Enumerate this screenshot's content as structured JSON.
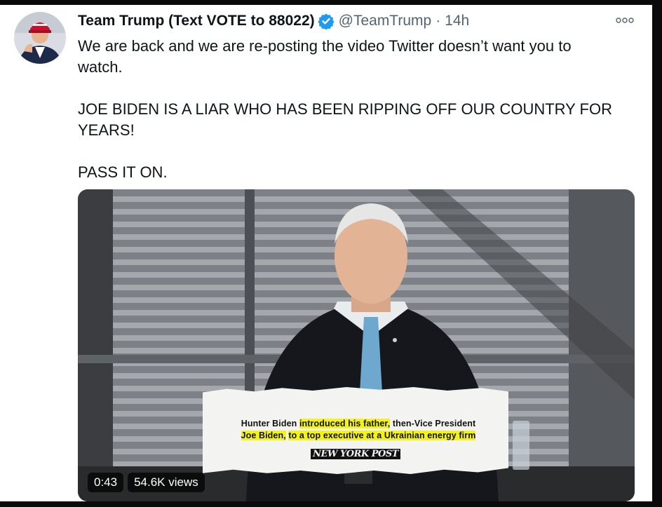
{
  "tweet": {
    "display_name": "Team Trump (Text VOTE to 88022)",
    "handle": "@TeamTrump",
    "separator": "·",
    "timestamp": "14h",
    "paragraphs": [
      "We are back and we are re-posting the video Twitter doesn’t want you to\nwatch.",
      "JOE BIDEN IS A LIAR WHO HAS BEEN RIPPING OFF OUR COUNTRY FOR\nYEARS!",
      "PASS IT ON."
    ]
  },
  "icons": {
    "verified": "verified-badge-icon",
    "more": "more-options-icon"
  },
  "video": {
    "caption": {
      "part1": "Hunter Biden ",
      "part2": "introduced his father,",
      "part3": " then-Vice President",
      "part4": "Joe Biden,",
      "part5": " ",
      "part6": "to a top executive at a Ukrainian energy firm"
    },
    "source_logo": "NEW YORK POST",
    "duration": "0:43",
    "views": "54.6K views"
  },
  "colors": {
    "verified": "#1d9bf0",
    "highlight": "#f3f31a",
    "text": "#0f1419",
    "secondary": "#536471"
  }
}
